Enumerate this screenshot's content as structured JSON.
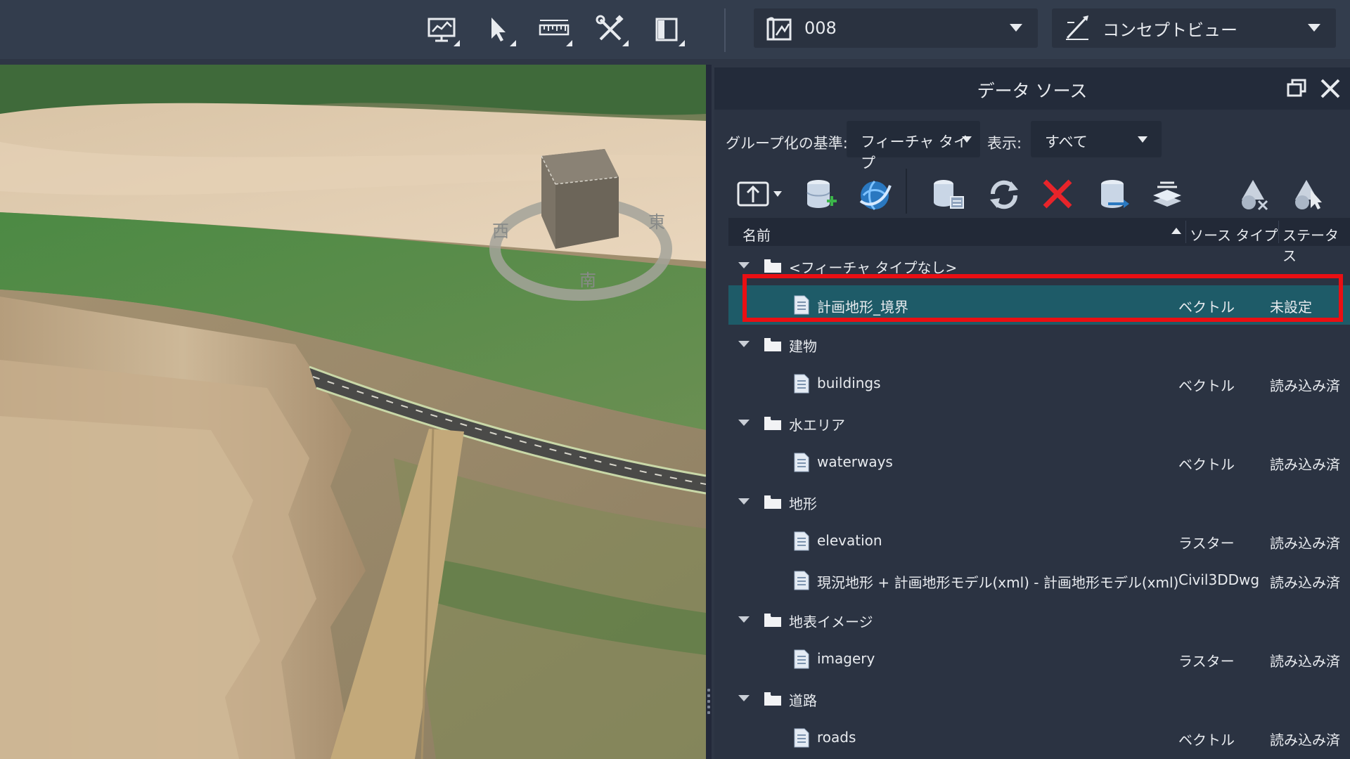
{
  "toolbar": {
    "buttons": [
      {
        "name": "presentation-display-icon"
      },
      {
        "name": "select-cursor-icon"
      },
      {
        "name": "measure-ruler-icon"
      },
      {
        "name": "tools-icon"
      },
      {
        "name": "panel-layout-icon"
      }
    ],
    "proposal_select": {
      "value": "008",
      "icon": "proposal-icon"
    },
    "view_select": {
      "value": "コンセプトビュー",
      "icon": "concept-view-icon"
    }
  },
  "viewport": {
    "compass": {
      "west": "西",
      "south": "南",
      "east": "東"
    }
  },
  "panel": {
    "title": "データ ソース",
    "group_label": "グループ化の基準:",
    "group_value": "フィーチャ タイプ",
    "display_label": "表示:",
    "display_value": "すべて",
    "columns": {
      "name": "名前",
      "source_type": "ソース タイプ",
      "status": "ステータス"
    },
    "tree": [
      {
        "type": "group",
        "label": "<フィーチャ タイプなし>"
      },
      {
        "type": "item",
        "label": "計画地形_境界",
        "source_type": "ベクトル",
        "status": "未設定",
        "selected": true
      },
      {
        "type": "group",
        "label": "建物"
      },
      {
        "type": "item",
        "label": "buildings",
        "source_type": "ベクトル",
        "status": "読み込み済"
      },
      {
        "type": "group",
        "label": "水エリア"
      },
      {
        "type": "item",
        "label": "waterways",
        "source_type": "ベクトル",
        "status": "読み込み済"
      },
      {
        "type": "group",
        "label": "地形"
      },
      {
        "type": "item",
        "label": "elevation",
        "source_type": "ラスター",
        "status": "読み込み済"
      },
      {
        "type": "item",
        "label": "現況地形 + 計画地形モデル(xml) - 計画地形モデル(xml)",
        "source_type": "Civil3DDwg",
        "status": "読み込み済"
      },
      {
        "type": "group",
        "label": "地表イメージ"
      },
      {
        "type": "item",
        "label": "imagery",
        "source_type": "ラスター",
        "status": "読み込み済"
      },
      {
        "type": "group",
        "label": "道路"
      },
      {
        "type": "item",
        "label": "roads",
        "source_type": "ベクトル",
        "status": "読み込み済"
      }
    ]
  },
  "colors": {
    "selected_row": "#1e5b68",
    "highlight_frame": "#ea0f13",
    "accent_blue": "#3aa0e0",
    "delete_red": "#e8242a"
  }
}
